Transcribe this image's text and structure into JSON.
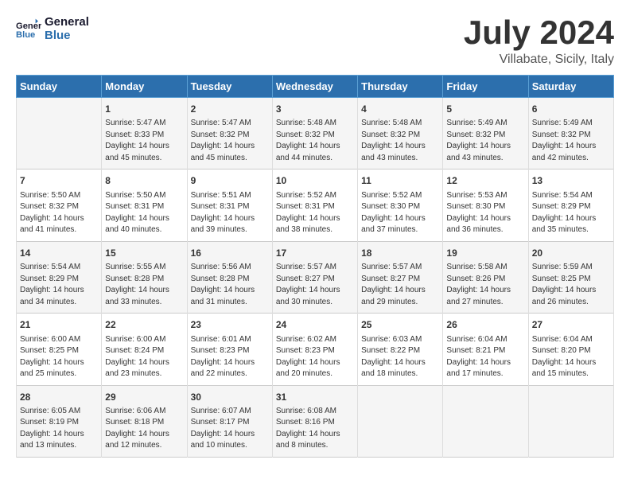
{
  "logo": {
    "line1": "General",
    "line2": "Blue"
  },
  "title": "July 2024",
  "subtitle": "Villabate, Sicily, Italy",
  "days_header": [
    "Sunday",
    "Monday",
    "Tuesday",
    "Wednesday",
    "Thursday",
    "Friday",
    "Saturday"
  ],
  "weeks": [
    [
      {
        "day": "",
        "info": ""
      },
      {
        "day": "1",
        "info": "Sunrise: 5:47 AM\nSunset: 8:33 PM\nDaylight: 14 hours\nand 45 minutes."
      },
      {
        "day": "2",
        "info": "Sunrise: 5:47 AM\nSunset: 8:32 PM\nDaylight: 14 hours\nand 45 minutes."
      },
      {
        "day": "3",
        "info": "Sunrise: 5:48 AM\nSunset: 8:32 PM\nDaylight: 14 hours\nand 44 minutes."
      },
      {
        "day": "4",
        "info": "Sunrise: 5:48 AM\nSunset: 8:32 PM\nDaylight: 14 hours\nand 43 minutes."
      },
      {
        "day": "5",
        "info": "Sunrise: 5:49 AM\nSunset: 8:32 PM\nDaylight: 14 hours\nand 43 minutes."
      },
      {
        "day": "6",
        "info": "Sunrise: 5:49 AM\nSunset: 8:32 PM\nDaylight: 14 hours\nand 42 minutes."
      }
    ],
    [
      {
        "day": "7",
        "info": "Sunrise: 5:50 AM\nSunset: 8:32 PM\nDaylight: 14 hours\nand 41 minutes."
      },
      {
        "day": "8",
        "info": "Sunrise: 5:50 AM\nSunset: 8:31 PM\nDaylight: 14 hours\nand 40 minutes."
      },
      {
        "day": "9",
        "info": "Sunrise: 5:51 AM\nSunset: 8:31 PM\nDaylight: 14 hours\nand 39 minutes."
      },
      {
        "day": "10",
        "info": "Sunrise: 5:52 AM\nSunset: 8:31 PM\nDaylight: 14 hours\nand 38 minutes."
      },
      {
        "day": "11",
        "info": "Sunrise: 5:52 AM\nSunset: 8:30 PM\nDaylight: 14 hours\nand 37 minutes."
      },
      {
        "day": "12",
        "info": "Sunrise: 5:53 AM\nSunset: 8:30 PM\nDaylight: 14 hours\nand 36 minutes."
      },
      {
        "day": "13",
        "info": "Sunrise: 5:54 AM\nSunset: 8:29 PM\nDaylight: 14 hours\nand 35 minutes."
      }
    ],
    [
      {
        "day": "14",
        "info": "Sunrise: 5:54 AM\nSunset: 8:29 PM\nDaylight: 14 hours\nand 34 minutes."
      },
      {
        "day": "15",
        "info": "Sunrise: 5:55 AM\nSunset: 8:28 PM\nDaylight: 14 hours\nand 33 minutes."
      },
      {
        "day": "16",
        "info": "Sunrise: 5:56 AM\nSunset: 8:28 PM\nDaylight: 14 hours\nand 31 minutes."
      },
      {
        "day": "17",
        "info": "Sunrise: 5:57 AM\nSunset: 8:27 PM\nDaylight: 14 hours\nand 30 minutes."
      },
      {
        "day": "18",
        "info": "Sunrise: 5:57 AM\nSunset: 8:27 PM\nDaylight: 14 hours\nand 29 minutes."
      },
      {
        "day": "19",
        "info": "Sunrise: 5:58 AM\nSunset: 8:26 PM\nDaylight: 14 hours\nand 27 minutes."
      },
      {
        "day": "20",
        "info": "Sunrise: 5:59 AM\nSunset: 8:25 PM\nDaylight: 14 hours\nand 26 minutes."
      }
    ],
    [
      {
        "day": "21",
        "info": "Sunrise: 6:00 AM\nSunset: 8:25 PM\nDaylight: 14 hours\nand 25 minutes."
      },
      {
        "day": "22",
        "info": "Sunrise: 6:00 AM\nSunset: 8:24 PM\nDaylight: 14 hours\nand 23 minutes."
      },
      {
        "day": "23",
        "info": "Sunrise: 6:01 AM\nSunset: 8:23 PM\nDaylight: 14 hours\nand 22 minutes."
      },
      {
        "day": "24",
        "info": "Sunrise: 6:02 AM\nSunset: 8:23 PM\nDaylight: 14 hours\nand 20 minutes."
      },
      {
        "day": "25",
        "info": "Sunrise: 6:03 AM\nSunset: 8:22 PM\nDaylight: 14 hours\nand 18 minutes."
      },
      {
        "day": "26",
        "info": "Sunrise: 6:04 AM\nSunset: 8:21 PM\nDaylight: 14 hours\nand 17 minutes."
      },
      {
        "day": "27",
        "info": "Sunrise: 6:04 AM\nSunset: 8:20 PM\nDaylight: 14 hours\nand 15 minutes."
      }
    ],
    [
      {
        "day": "28",
        "info": "Sunrise: 6:05 AM\nSunset: 8:19 PM\nDaylight: 14 hours\nand 13 minutes."
      },
      {
        "day": "29",
        "info": "Sunrise: 6:06 AM\nSunset: 8:18 PM\nDaylight: 14 hours\nand 12 minutes."
      },
      {
        "day": "30",
        "info": "Sunrise: 6:07 AM\nSunset: 8:17 PM\nDaylight: 14 hours\nand 10 minutes."
      },
      {
        "day": "31",
        "info": "Sunrise: 6:08 AM\nSunset: 8:16 PM\nDaylight: 14 hours\nand 8 minutes."
      },
      {
        "day": "",
        "info": ""
      },
      {
        "day": "",
        "info": ""
      },
      {
        "day": "",
        "info": ""
      }
    ]
  ]
}
